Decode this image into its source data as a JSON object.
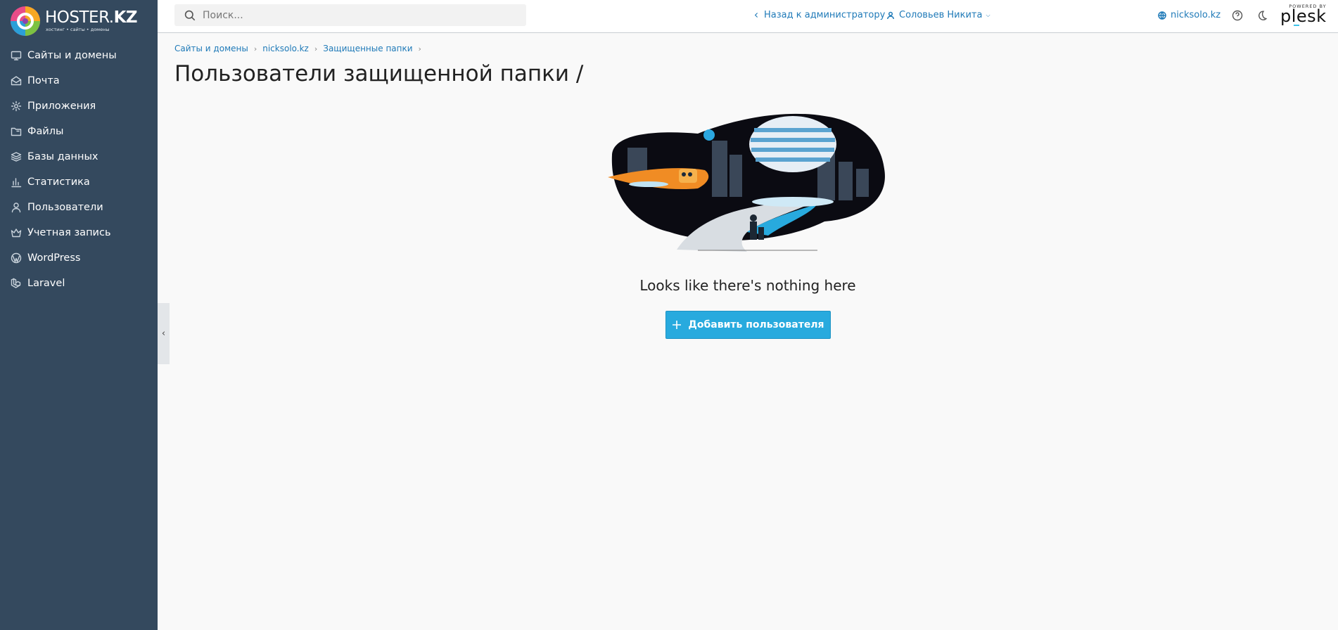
{
  "brand": {
    "name_part1": "HOSTER.",
    "name_part2": "KZ",
    "tagline": "хостинг • сайты • домены"
  },
  "sidebar": {
    "items": [
      {
        "label": "Сайты и домены",
        "icon": "monitor-icon"
      },
      {
        "label": "Почта",
        "icon": "mail-icon"
      },
      {
        "label": "Приложения",
        "icon": "gear-icon"
      },
      {
        "label": "Файлы",
        "icon": "folder-icon"
      },
      {
        "label": "Базы данных",
        "icon": "layers-icon"
      },
      {
        "label": "Статистика",
        "icon": "bar-chart-icon"
      },
      {
        "label": "Пользователи",
        "icon": "user-icon"
      },
      {
        "label": "Учетная запись",
        "icon": "crown-icon"
      },
      {
        "label": "WordPress",
        "icon": "wordpress-icon"
      },
      {
        "label": "Laravel",
        "icon": "laravel-icon"
      }
    ],
    "collapse_glyph": "‹"
  },
  "header": {
    "search_placeholder": "Поиск...",
    "back_label": "Назад к администратору",
    "user_label": "Соловьев Никита",
    "domain_label": "nicksolo.kz",
    "powered_by": "POWERED BY",
    "plesk": "plesk"
  },
  "breadcrumb": [
    "Сайты и домены",
    "nicksolo.kz",
    "Защищенные папки"
  ],
  "page": {
    "title": "Пользователи защищенной папки /",
    "empty_message": "Looks like there's nothing here",
    "add_button_label": "Добавить пользователя"
  },
  "colors": {
    "sidebar_bg": "#34495e",
    "accent": "#28aade",
    "link": "#1f7ab8"
  }
}
